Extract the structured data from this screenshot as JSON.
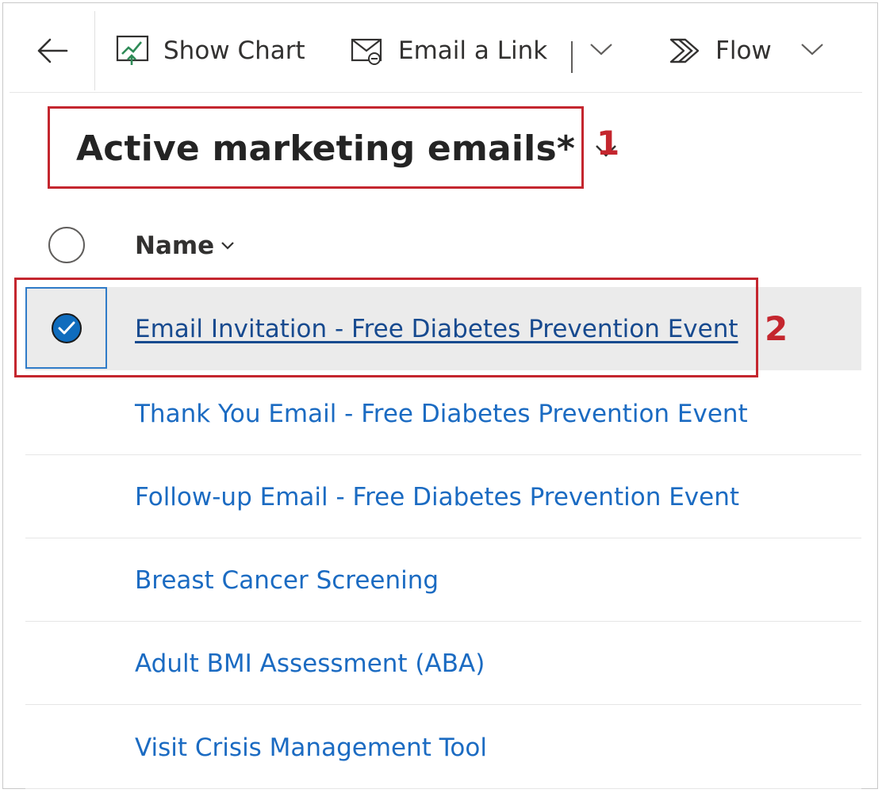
{
  "toolbar": {
    "back_icon": "arrow-left-icon",
    "show_chart_label": "Show Chart",
    "show_chart_icon": "chart-icon",
    "email_link_label": "Email a Link",
    "email_link_icon": "email-link-icon",
    "flow_label": "Flow",
    "flow_icon": "flow-icon"
  },
  "view": {
    "title": "Active marketing emails*"
  },
  "annotations": {
    "step1": "1",
    "step2": "2",
    "color": "#c4262e"
  },
  "grid": {
    "name_header": "Name",
    "rows": [
      {
        "name": "Email Invitation - Free Diabetes Prevention Event",
        "selected": true
      },
      {
        "name": "Thank You Email - Free Diabetes Prevention Event",
        "selected": false
      },
      {
        "name": "Follow-up Email - Free Diabetes Prevention Event",
        "selected": false
      },
      {
        "name": "Breast Cancer Screening",
        "selected": false
      },
      {
        "name": "Adult BMI Assessment (ABA)",
        "selected": false
      },
      {
        "name": "Visit Crisis Management Tool",
        "selected": false
      }
    ]
  },
  "colors": {
    "link": "#1b6bc2",
    "selected_row_bg": "#ebebeb",
    "check_fill": "#0f6cbd"
  }
}
